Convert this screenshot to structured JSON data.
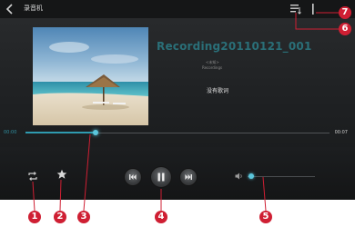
{
  "header": {
    "title": "录音机"
  },
  "track": {
    "title": "Recording20110121_001",
    "artist": "<未知>",
    "album": "Recordings",
    "lyrics_status": "没有歌词"
  },
  "progress": {
    "current_time": "00:00",
    "total_time": "00:07",
    "position": 0.23
  },
  "volume": {
    "level": 0.05
  },
  "icons": {
    "back": "back-arrow-icon",
    "list": "playlist-icon",
    "more": "more-vert-icon",
    "repeat": "repeat-icon",
    "favorite": "star-icon",
    "prev": "previous-icon",
    "play": "pause-icon",
    "next": "next-icon",
    "volume": "speaker-icon"
  },
  "callouts": [
    "1",
    "2",
    "3",
    "4",
    "5",
    "6",
    "7"
  ],
  "colors": {
    "accent": "#2f9bb0",
    "callout": "#cf1f33"
  }
}
